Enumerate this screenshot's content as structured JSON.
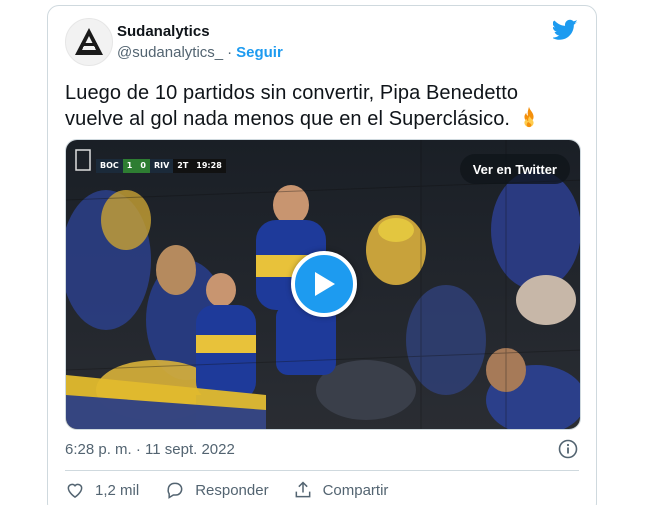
{
  "tweet": {
    "author": {
      "name": "Sudanalytics",
      "handle": "@sudanalytics_",
      "separator": "·",
      "follow_label": "Seguir"
    },
    "text": "Luego de 10 partidos sin convertir, Pipa Benedetto vuelve al gol nada menos que en el Superclásico.",
    "media": {
      "scoreboard": {
        "home": "BOC",
        "home_score": "1",
        "away_score": "0",
        "away": "RIV",
        "period": "2T",
        "clock": "19:28"
      },
      "view_on_twitter_label": "Ver en Twitter"
    },
    "timestamp": "6:28 p. m. · 11 sept. 2022",
    "actions": {
      "likes": "1,2 mil",
      "reply_label": "Responder",
      "share_label": "Compartir"
    },
    "colors": {
      "accent": "#1d9bf0",
      "secondary_text": "#536471",
      "border": "#cfd9de"
    }
  }
}
